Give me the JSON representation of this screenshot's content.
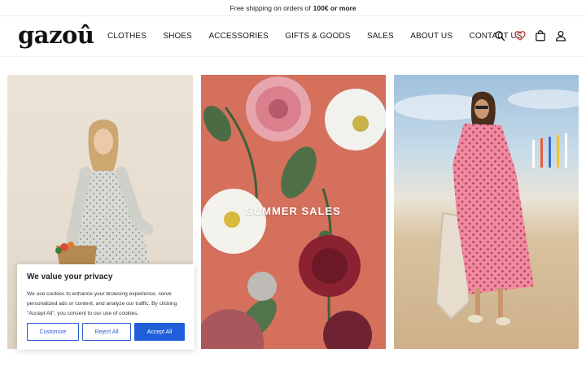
{
  "announcement": {
    "text": "Free shipping on orders of",
    "bold": "100€ or more"
  },
  "brand": {
    "logo": "gazoû"
  },
  "nav": {
    "items": [
      {
        "label": "CLOTHES"
      },
      {
        "label": "SHOES"
      },
      {
        "label": "ACCESSORIES"
      },
      {
        "label": "GIFTS & GOODS"
      },
      {
        "label": "SALES"
      },
      {
        "label": "ABOUT US"
      },
      {
        "label": "CONTACT US"
      }
    ]
  },
  "header_icons": [
    "search-icon",
    "heart-icon",
    "shopping-bag-icon",
    "user-icon"
  ],
  "tiles": [
    {
      "label": ""
    },
    {
      "label": "SUMMER SALES"
    },
    {
      "label": ""
    }
  ],
  "cookie_banner": {
    "title": "We value your privacy",
    "body": "We use cookies to enhance your browsing experience, serve personalized ads or content, and analyze our traffic. By clicking \"Accept All\", you consent to our use of cookies.",
    "customize": "Customize",
    "reject": "Reject All",
    "accept": "Accept All"
  },
  "colors": {
    "accent": "#1f5ed8",
    "heart": "#c0392b",
    "sales_tile_bg": "#d4705c"
  }
}
